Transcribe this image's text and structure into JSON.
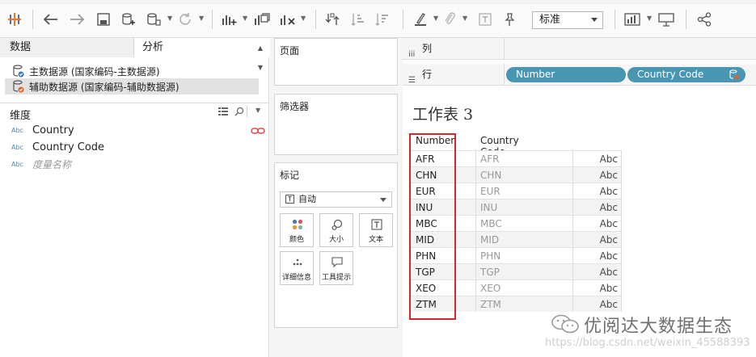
{
  "toolbar": {
    "icons": [
      "logo-icon",
      "back-icon",
      "forward-icon",
      "save-icon",
      "new-datasource-icon",
      "datasource-icon",
      "refresh-icon",
      "new-worksheet-icon",
      "duplicate-icon",
      "clear-icon",
      "swap-icon",
      "sort-asc-icon",
      "sort-desc-icon",
      "highlight-icon",
      "group-icon",
      "label-icon",
      "pin-icon",
      "show-me-icon",
      "presentation-icon",
      "share-icon"
    ],
    "fit_select": "标准"
  },
  "data_pane": {
    "tabs": {
      "data": "数据",
      "analysis": "分析"
    },
    "datasources": [
      {
        "label": "主数据源 (国家编码-主数据源)",
        "selected": false
      },
      {
        "label": "辅助数据源 (国家编码-辅助数据源)",
        "selected": true
      }
    ],
    "dimensions_title": "维度",
    "field_type_badge": "Abc",
    "fields": [
      {
        "name": "Country",
        "linked": true
      },
      {
        "name": "Country Code",
        "linked": false
      },
      {
        "name": "度量名称",
        "linked": false
      }
    ]
  },
  "cards": {
    "pages": "页面",
    "filters": "筛选器",
    "marks": "标记",
    "mark_type": "自动",
    "mark_buttons": [
      "颜色",
      "大小",
      "文本",
      "详细信息",
      "工具提示"
    ]
  },
  "shelves": {
    "columns_label": "列",
    "rows_label": "行",
    "row_pills": [
      "Number",
      "Country Code"
    ]
  },
  "view": {
    "sheet_title": "工作表 3",
    "headers": [
      "Number",
      "Country Code"
    ],
    "rows": [
      {
        "number": "AFR",
        "code": "AFR",
        "value": "Abc"
      },
      {
        "number": "CHN",
        "code": "CHN",
        "value": "Abc"
      },
      {
        "number": "EUR",
        "code": "EUR",
        "value": "Abc"
      },
      {
        "number": "INU",
        "code": "INU",
        "value": "Abc"
      },
      {
        "number": "MBC",
        "code": "MBC",
        "value": "Abc"
      },
      {
        "number": "MID",
        "code": "MID",
        "value": "Abc"
      },
      {
        "number": "PHN",
        "code": "PHN",
        "value": "Abc"
      },
      {
        "number": "TGP",
        "code": "TGP",
        "value": "Abc"
      },
      {
        "number": "XEO",
        "code": "XEO",
        "value": "Abc"
      },
      {
        "number": "ZTM",
        "code": "ZTM",
        "value": "Abc"
      }
    ]
  },
  "watermark": {
    "text": "优阅达大数据生态",
    "url": "https://blog.csdn.net/weixin_45588393"
  },
  "colors": {
    "pill": "#4996b2",
    "highlight": "#d7262c",
    "link": "#e04a4a"
  }
}
